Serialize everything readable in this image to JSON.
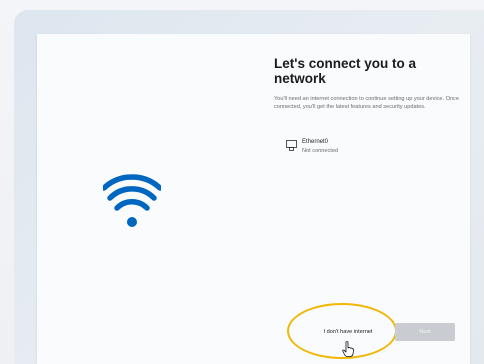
{
  "oobe": {
    "title": "Let's connect you to a network",
    "description": "You'll need an internet connection to continue setting up your device. Once connected, you'll get the latest features and security updates.",
    "network": {
      "name": "Ethernet0",
      "status": "Not connected",
      "icon": "ethernet-icon"
    },
    "hero_icon": "wifi-icon",
    "buttons": {
      "no_internet": "I don't have internet",
      "next": "Next"
    }
  },
  "colors": {
    "accent": "#0067c0",
    "highlight": "#f2b705",
    "next_disabled": "#c9ccd1"
  },
  "cursor": "hand-pointer-icon"
}
